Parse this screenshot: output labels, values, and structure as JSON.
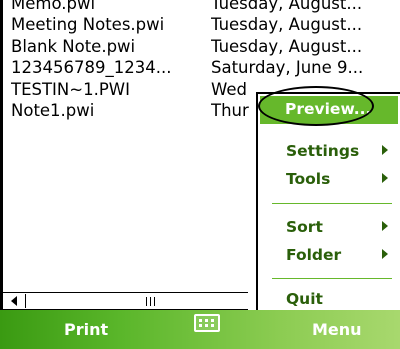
{
  "file_list": {
    "rows": [
      {
        "name": "Memo.pwi",
        "date": "Tuesday, August..."
      },
      {
        "name": "Meeting Notes.pwi",
        "date": "Tuesday, August..."
      },
      {
        "name": "Blank Note.pwi",
        "date": "Tuesday, August..."
      },
      {
        "name": "123456789_1234...",
        "date": "Saturday, June 9..."
      },
      {
        "name": "TESTIN~1.PWI",
        "date": "Wed"
      },
      {
        "name": "Note1.pwi",
        "date": "Thur"
      }
    ]
  },
  "menu": {
    "items": [
      {
        "label": "Preview...",
        "selected": true
      },
      {
        "label": "Settings",
        "submenu": true
      },
      {
        "label": "Tools",
        "submenu": true
      },
      {
        "label": "Sort",
        "submenu": true
      },
      {
        "label": "Folder",
        "submenu": true
      },
      {
        "label": "Quit"
      }
    ]
  },
  "softkeys": {
    "left": "Print",
    "right": "Menu",
    "center_icon": "keyboard-icon"
  },
  "colors": {
    "accent": "#66b82b",
    "menu_text": "#2a5f0a"
  }
}
